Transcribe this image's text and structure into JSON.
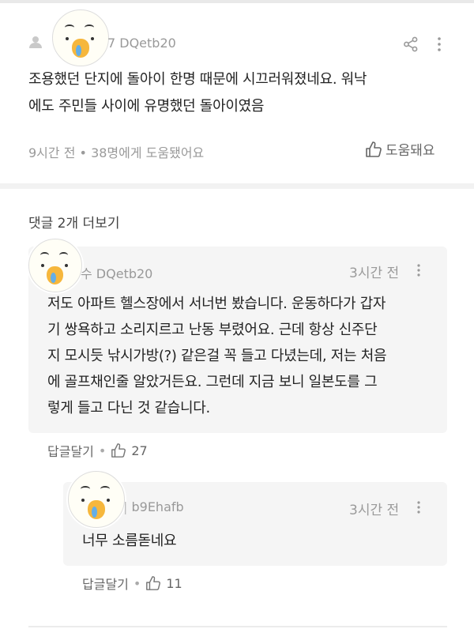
{
  "main_comment": {
    "author": "7 DQetb20",
    "text_line1": "조용했던 단지에 돌아이 한명 때문에 시끄러워졌네요. 워낙",
    "text_line2": "에도 주민들 사이에 유명했던 돌아이였음",
    "time": "9시간 전",
    "helpful_count_text": "38명에게 도움됐어요",
    "helpful_button": "도움돼요"
  },
  "more_replies": "댓글 2개 더보기",
  "reply1": {
    "author": "수 DQetb20",
    "time": "3시간 전",
    "lines": [
      "저도 아파트 헬스장에서 서너번 봤습니다. 운동하다가 갑자",
      "기 쌍욕하고 소리지르고 난동 부렸어요. 근데 항상 신주단",
      "지 모시듯 낚시가방(?) 같은걸 꼭 들고 다녔는데, 저는 처음",
      "에 골프채인줄 알았거든요. 그런데 지금 보니 일본도를 그",
      "렇게 들고 다닌 것 같습니다."
    ],
    "reply_label": "답글달기",
    "likes": "27"
  },
  "reply2": {
    "author": "b9Ehafb",
    "time": "3시간 전",
    "text": "너무 소름돋네요",
    "reply_label": "답글달기",
    "likes": "11"
  },
  "icons": {
    "share": "share-icon",
    "more": "more-vertical-icon",
    "thumbs_up": "thumbs-up-icon",
    "user": "user-icon"
  }
}
